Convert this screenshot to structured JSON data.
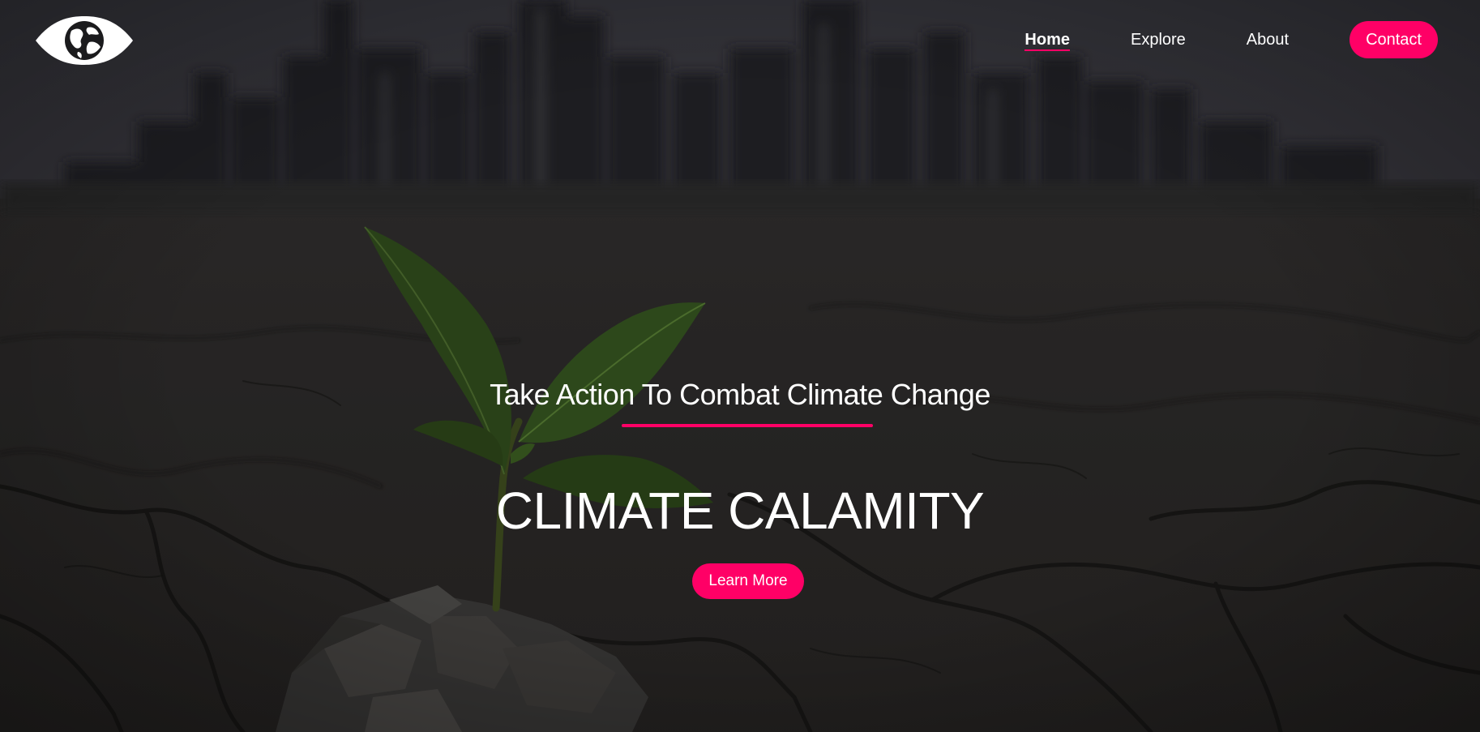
{
  "nav": {
    "logo_icon": "eye-globe-icon",
    "links": [
      {
        "label": "Home",
        "active": true
      },
      {
        "label": "Explore",
        "active": false
      },
      {
        "label": "About",
        "active": false
      }
    ],
    "contact_label": "Contact"
  },
  "hero": {
    "tagline": "Take Action To Combat Climate Change",
    "headline": "CLIMATE CALAMITY",
    "cta_label": "Learn More",
    "background_image": "seedling-in-cracked-earth-city-skyline"
  },
  "colors": {
    "accent": "#ff0066",
    "text": "#ffffff",
    "overlay": "#1e1d20"
  }
}
